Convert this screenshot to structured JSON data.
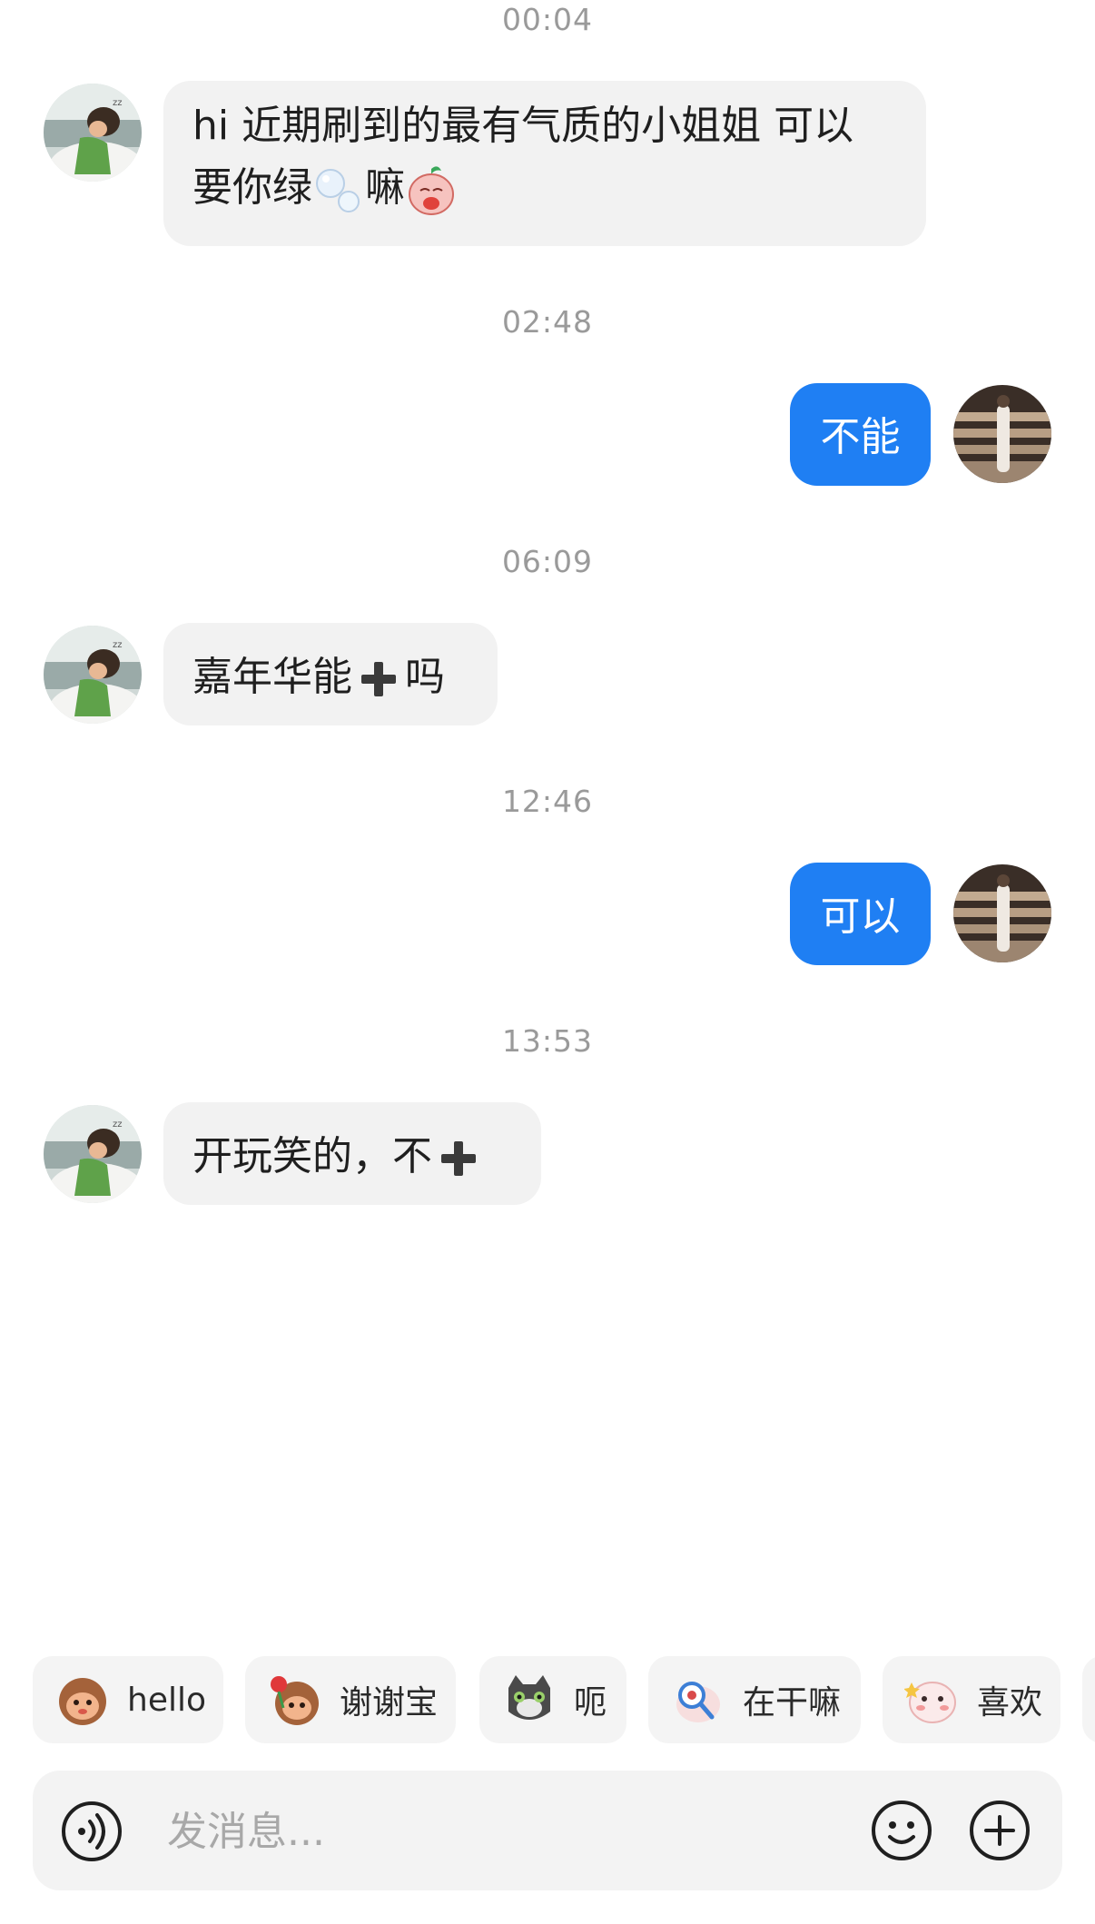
{
  "chat": {
    "messages": [
      {
        "time": "00:04",
        "direction": "in",
        "text": "hi 近期刷到的最有气质的小姐姐 可以",
        "text2": "要你绿",
        "text3": "嘛"
      },
      {
        "time": "02:48",
        "direction": "out",
        "text": "不能"
      },
      {
        "time": "06:09",
        "direction": "in",
        "text": "嘉年华能",
        "text2": "吗"
      },
      {
        "time": "12:46",
        "direction": "out",
        "text": "可以"
      },
      {
        "time": "13:53",
        "direction": "in",
        "text": "开玩笑的，不"
      }
    ]
  },
  "quick_replies": [
    {
      "label": "hello",
      "icon": "monkey-sticker-icon"
    },
    {
      "label": "谢谢宝",
      "icon": "monkey-rose-sticker-icon"
    },
    {
      "label": "呃",
      "icon": "cat-sticker-icon"
    },
    {
      "label": "在干嘛",
      "icon": "magnifier-sticker-icon"
    },
    {
      "label": "喜欢",
      "icon": "blush-sticker-icon"
    }
  ],
  "input": {
    "placeholder": "发消息..."
  },
  "icons": {
    "voice": "voice-icon",
    "emoji": "emoji-icon",
    "plus": "plus-icon"
  },
  "colors": {
    "outgoing_bubble": "#1f7ff3",
    "incoming_bubble": "#f2f2f2",
    "timestamp": "#9a9a9a"
  }
}
